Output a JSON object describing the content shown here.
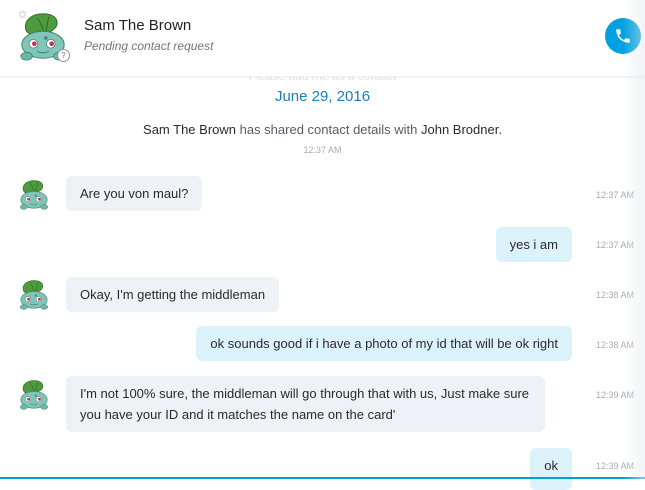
{
  "header": {
    "contact_name": "Sam The Brown",
    "contact_status": "Pending contact request",
    "star_glyph": "✩",
    "info_glyph": "?"
  },
  "conversation": {
    "faded_notice": "Please add me as a contact",
    "date": "June 29, 2016",
    "system_message": {
      "actor": "Sam The Brown",
      "text": " has shared contact details with ",
      "target": "John Brodner",
      "suffix": ".",
      "time": "12:37 AM"
    },
    "messages": [
      {
        "direction": "in",
        "text": "Are you von maul?",
        "time": "12:37 AM"
      },
      {
        "direction": "out",
        "text": "yes i am",
        "time": "12:37 AM"
      },
      {
        "direction": "in",
        "text": "Okay, I'm getting the middleman",
        "time": "12:38 AM"
      },
      {
        "direction": "out",
        "text": "ok sounds good if i have a photo of my id that will be ok right",
        "time": "12:38 AM"
      },
      {
        "direction": "in",
        "text": "I'm not 100% sure, the middleman will go through that with us, Just make sure you have your ID and it matches the name on the card'",
        "time": "12:39 AM"
      },
      {
        "direction": "out",
        "text": "ok",
        "time": "12:39 AM"
      }
    ]
  },
  "colors": {
    "accent": "#00a1e0",
    "date": "#1a7fb5",
    "incoming_bubble": "#eef1f5",
    "outgoing_bubble": "#dcf2fb"
  },
  "icons": [
    "contact-avatar-icon",
    "favorite-star-icon",
    "contact-info-icon",
    "call-phone-icon"
  ]
}
